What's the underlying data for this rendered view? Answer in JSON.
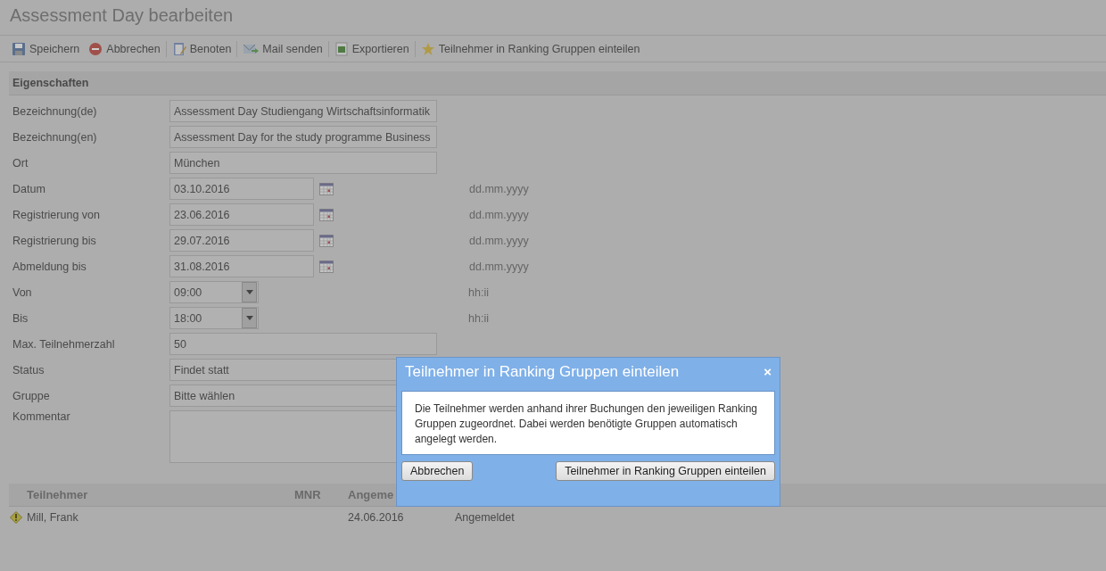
{
  "title": "Assessment Day bearbeiten",
  "toolbar": [
    {
      "label": "Speichern",
      "kind": "save"
    },
    {
      "label": "Abbrechen",
      "kind": "cancel"
    },
    {
      "label": "Benoten",
      "kind": "grade"
    },
    {
      "label": "Mail senden",
      "kind": "mail"
    },
    {
      "label": "Exportieren",
      "kind": "export"
    },
    {
      "label": "Teilnehmer in Ranking Gruppen einteilen",
      "kind": "star"
    }
  ],
  "section": "Eigenschaften",
  "fields": [
    {
      "label": "Bezeichnung(de)",
      "kind": "text",
      "value": "Assessment Day Studiengang Wirtschaftsinformatik"
    },
    {
      "label": "Bezeichnung(en)",
      "kind": "text",
      "value": "Assessment Day for the study programme Business"
    },
    {
      "label": "Ort",
      "kind": "text",
      "value": "München"
    },
    {
      "label": "Datum",
      "kind": "date",
      "value": "03.10.2016",
      "hint": "dd.mm.yyyy"
    },
    {
      "label": "Registrierung von",
      "kind": "date",
      "value": "23.06.2016",
      "hint": "dd.mm.yyyy"
    },
    {
      "label": "Registrierung bis",
      "kind": "date",
      "value": "29.07.2016",
      "hint": "dd.mm.yyyy"
    },
    {
      "label": "Abmeldung bis",
      "kind": "date",
      "value": "31.08.2016",
      "hint": "dd.mm.yyyy"
    },
    {
      "label": "Von",
      "kind": "time",
      "value": "09:00",
      "hint": "hh:ii"
    },
    {
      "label": "Bis",
      "kind": "time",
      "value": "18:00",
      "hint": "hh:ii"
    },
    {
      "label": "Max. Teilnehmerzahl",
      "kind": "text",
      "value": "50"
    },
    {
      "label": "Status",
      "kind": "text",
      "value": "Findet statt"
    },
    {
      "label": "Gruppe",
      "kind": "text",
      "value": "Bitte wählen"
    },
    {
      "label": "Kommentar",
      "kind": "textarea"
    }
  ],
  "table": {
    "columns": [
      "Teilnehmer",
      "MNR",
      "Angeme"
    ],
    "rows": [
      {
        "warning": true,
        "cells": [
          "Mill, Frank",
          null,
          "24.06.2016",
          "Angemeldet"
        ]
      }
    ]
  },
  "dialog": {
    "title": "Teilnehmer in Ranking Gruppen einteilen",
    "close": "×",
    "message": "Die Teilnehmer werden anhand ihrer Buchungen den jeweiligen Ranking Gruppen zugeordnet. Dabei werden benötigte Gruppen automatisch angelegt werden.",
    "buttons": [
      "Abbrechen",
      "Teilnehmer in Ranking Gruppen einteilen"
    ]
  }
}
